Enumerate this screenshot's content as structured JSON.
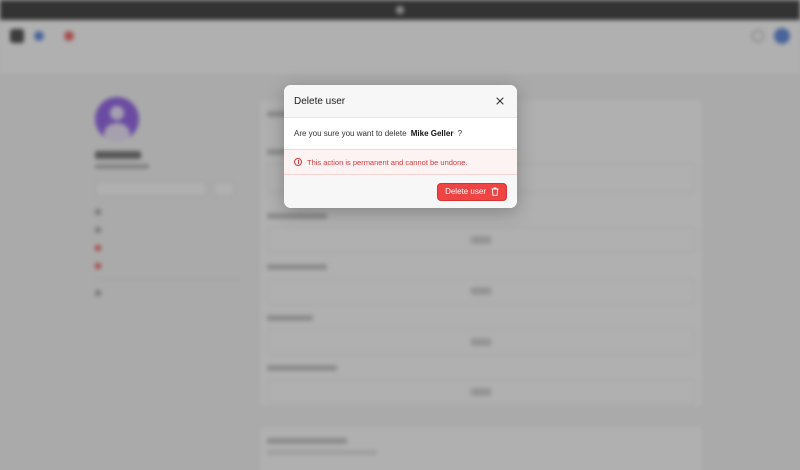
{
  "modal": {
    "title": "Delete user",
    "close_icon": "close-icon",
    "message_prefix": "Are you sure you want to delete",
    "user_name": "Mike Geller",
    "message_suffix": "?",
    "warning": "This action is permanent and cannot be undone.",
    "warning_icon": "alert-circle-icon",
    "confirm_label": "Delete user",
    "confirm_icon": "trash-icon"
  },
  "colors": {
    "danger": "#ef4444",
    "danger_text": "#d9373a",
    "overlay": "rgba(90,90,90,0.48)"
  }
}
